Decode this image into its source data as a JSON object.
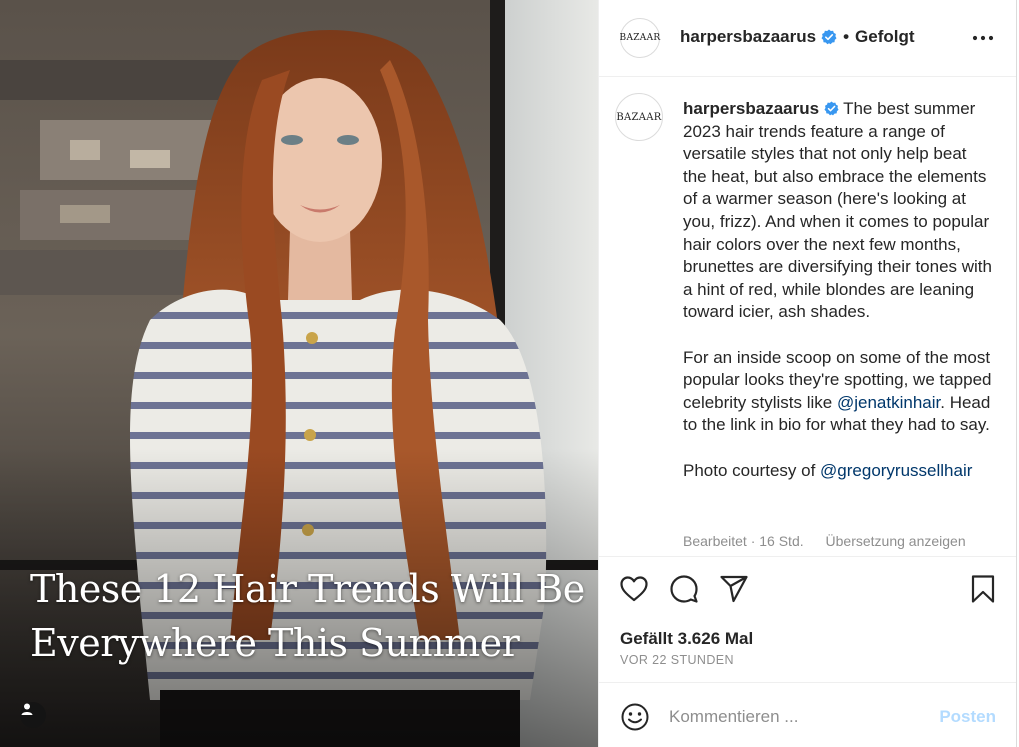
{
  "photo": {
    "headline_line1": "These 12 Hair Trends Will Be",
    "headline_line2": "Everywhere This Summer",
    "tag_icon": "user-icon"
  },
  "header": {
    "avatar_text": "BAZAAR",
    "username": "harpersbazaarus",
    "verified_icon": "verified-badge-icon",
    "separator": "•",
    "follow_state": "Gefolgt",
    "more_icon": "more-options-icon"
  },
  "caption": {
    "avatar_text": "BAZAAR",
    "username": "harpersbazaarus",
    "paragraph1": "The best summer 2023 hair trends feature a range of versatile styles that not only help beat the heat, but also embrace the elements of a warmer season (here's looking at you, frizz). And when it comes to popular hair colors over the next few months, brunettes are diversifying their tones with a hint of red, while blondes are leaning toward icier, ash shades.",
    "paragraph2_before": "For an inside scoop on some of the most popular looks they're spotting, we tapped celebrity stylists like ",
    "paragraph2_mention": "@jenatkinhair",
    "paragraph2_after": ". Head to the link in bio for what they had to say.",
    "paragraph3_before": "Photo courtesy of ",
    "paragraph3_mention": "@gregoryrussellhair",
    "meta_edited": "Bearbeitet · 16 Std.",
    "meta_translate": "Übersetzung anzeigen"
  },
  "actions": {
    "like_icon": "heart-icon",
    "comment_icon": "comment-icon",
    "share_icon": "share-icon",
    "save_icon": "bookmark-icon",
    "likes_text": "Gefällt 3.626 Mal",
    "time_ago": "VOR 22 STUNDEN"
  },
  "comment": {
    "emoji_icon": "emoji-icon",
    "placeholder": "Kommentieren ...",
    "post_label": "Posten"
  },
  "colors": {
    "link": "#00376b",
    "verified": "#3897f0",
    "post_disabled": "#b3dbff",
    "muted": "#8e8e8e"
  }
}
